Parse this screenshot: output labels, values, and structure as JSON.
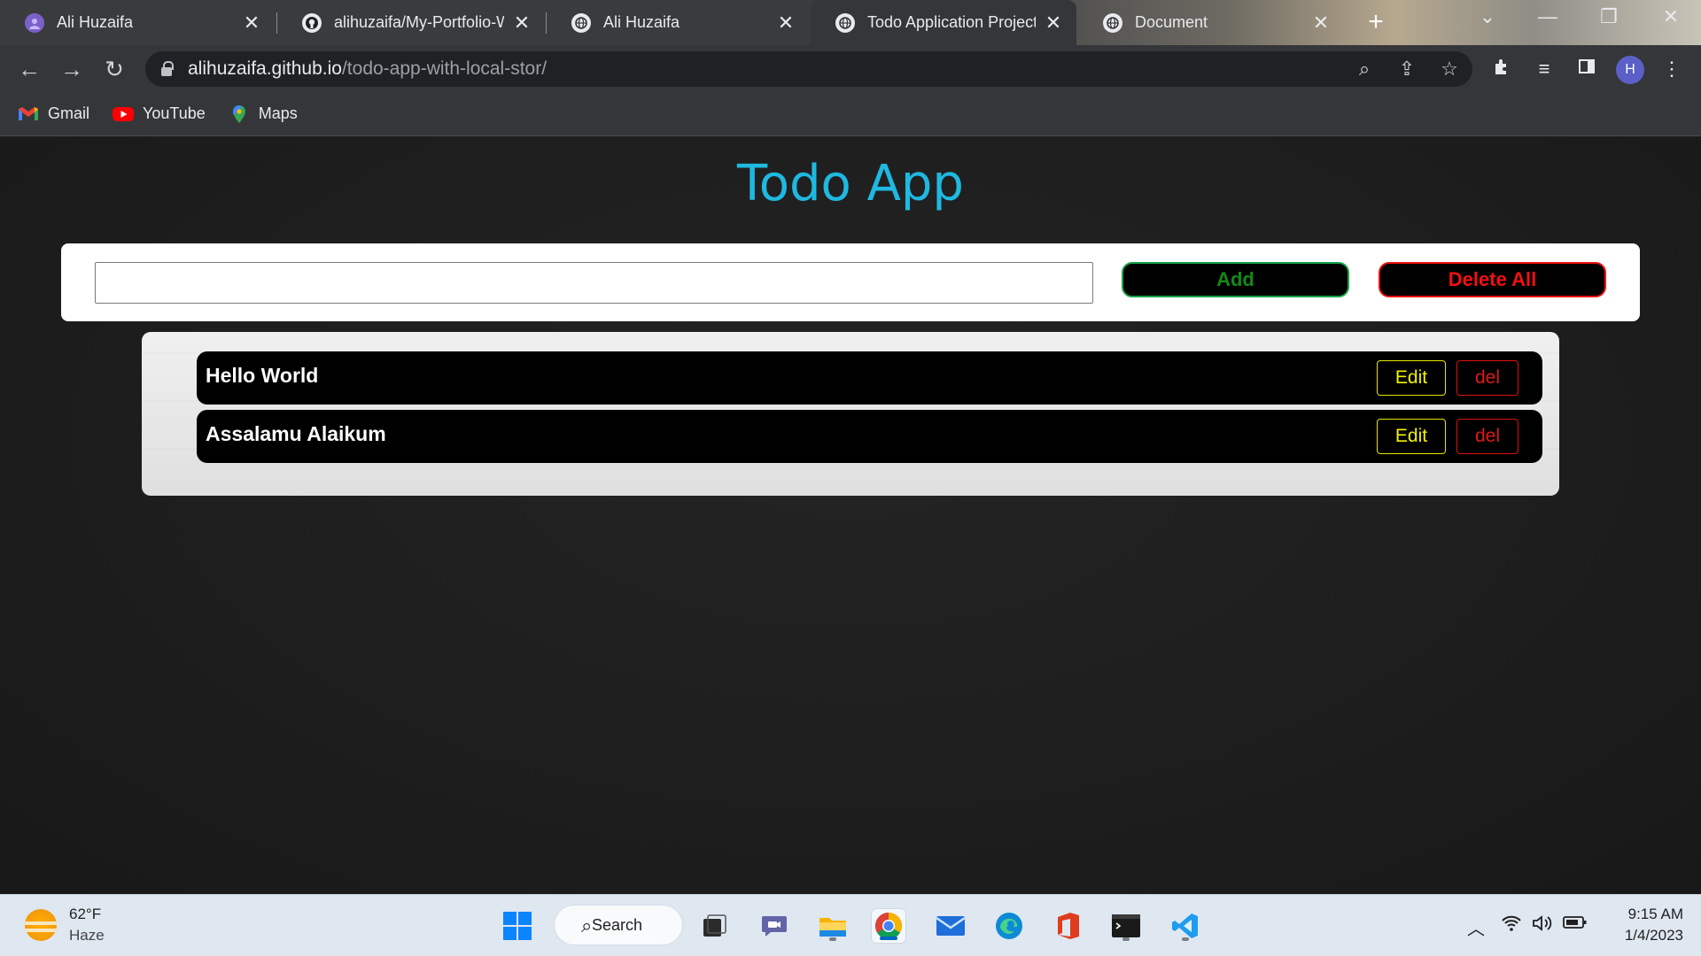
{
  "browser": {
    "tabs": [
      {
        "title": "Ali Huzaifa",
        "icon": "ali-huzaifa-favicon",
        "active": false
      },
      {
        "title": "alihuzaifa/My-Portfolio-W",
        "icon": "github-icon",
        "active": false
      },
      {
        "title": "Ali Huzaifa",
        "icon": "globe-icon",
        "active": false
      },
      {
        "title": "Todo Application Project",
        "icon": "globe-icon",
        "active": true
      },
      {
        "title": "Document",
        "icon": "globe-icon",
        "active": false
      }
    ],
    "url_host": "alihuzaifa.github.io",
    "url_path": "/todo-app-with-local-stor/",
    "profile_initial": "H",
    "bookmarks": [
      {
        "label": "Gmail",
        "icon": "gmail-icon"
      },
      {
        "label": "YouTube",
        "icon": "youtube-icon"
      },
      {
        "label": "Maps",
        "icon": "maps-icon"
      }
    ]
  },
  "app": {
    "title": "Todo App",
    "input_value": "",
    "add_label": "Add",
    "delete_all_label": "Delete All",
    "todos": [
      {
        "text": "Hello World",
        "edit_label": "Edit",
        "del_label": "del"
      },
      {
        "text": "Assalamu Alaikum",
        "edit_label": "Edit",
        "del_label": "del"
      }
    ],
    "colors": {
      "title": "#1fb8e0",
      "add": "#138a13",
      "delete": "#f21010",
      "edit": "#f2f200"
    }
  },
  "taskbar": {
    "weather_temp": "62°F",
    "weather_cond": "Haze",
    "search_label": "Search",
    "time": "9:15 AM",
    "date": "1/4/2023"
  }
}
